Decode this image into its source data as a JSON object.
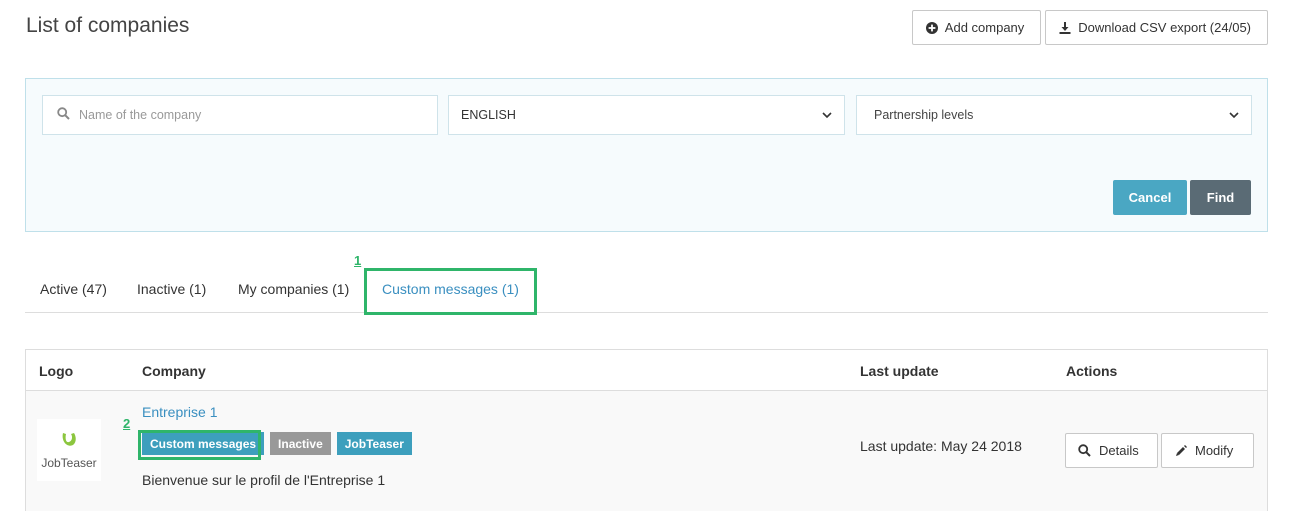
{
  "page": {
    "title": "List of companies"
  },
  "top_actions": {
    "add_company": "Add company",
    "download_csv": "Download CSV export (24/05)"
  },
  "filters": {
    "search_placeholder": "Name of the company",
    "language": "ENGLISH",
    "partnership": "Partnership levels",
    "cancel": "Cancel",
    "find": "Find"
  },
  "tabs": [
    {
      "label": "Active (47)"
    },
    {
      "label": "Inactive (1)"
    },
    {
      "label": "My companies (1)"
    },
    {
      "label": "Custom messages (1)"
    }
  ],
  "annotations": {
    "first": "1",
    "second": "2",
    "color": "#2fb56a"
  },
  "table": {
    "headers": {
      "logo": "Logo",
      "company": "Company",
      "last_update": "Last update",
      "actions": "Actions"
    },
    "rows": [
      {
        "logo_text": "JobTeaser",
        "company": "Entreprise 1",
        "badges": [
          "Custom messages",
          "Inactive",
          "JobTeaser"
        ],
        "description": "Bienvenue sur le profil de l'Entreprise 1",
        "last_update": "Last update: May 24 2018",
        "details": "Details",
        "modify": "Modify"
      }
    ]
  },
  "colors": {
    "accent": "#3a8fc0",
    "cancel": "#4aa7c3",
    "find": "#5a6b75",
    "badge": "#3d9fbd",
    "inactive_badge": "#999999"
  },
  "icons": {
    "add": "plus-circle-icon",
    "download": "download-icon",
    "search": "search-icon",
    "chevron": "chevron-down-icon",
    "edit": "pencil-icon",
    "logo": "jobteaser-logo-icon"
  }
}
